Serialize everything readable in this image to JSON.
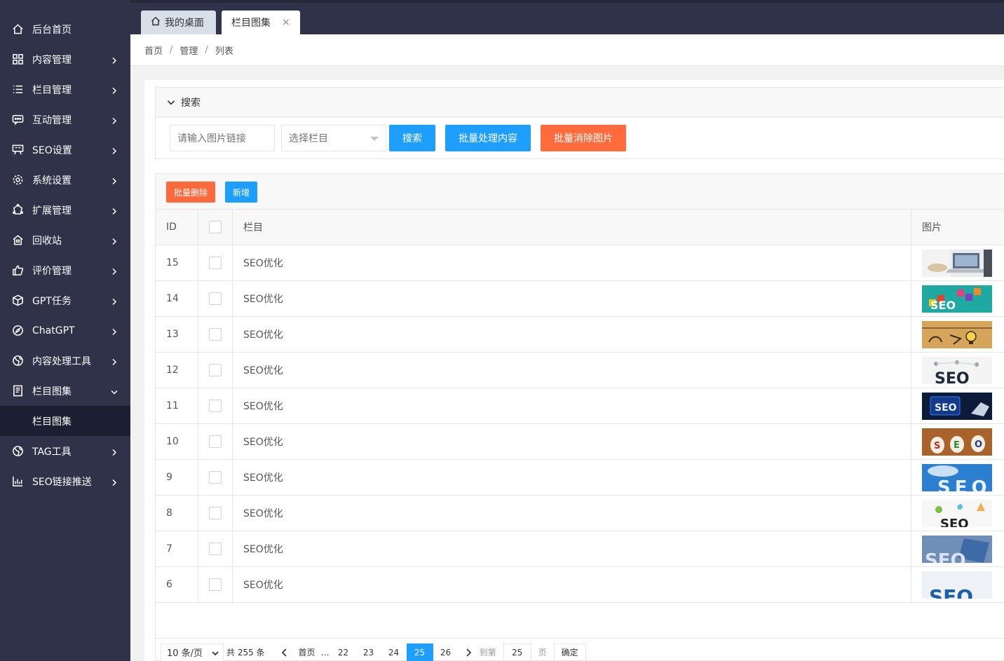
{
  "sidebar": {
    "items": [
      {
        "label": "后台首页",
        "icon": "home-icon",
        "chevron": false
      },
      {
        "label": "内容管理",
        "icon": "grid-icon",
        "chevron": true
      },
      {
        "label": "栏目管理",
        "icon": "list-icon",
        "chevron": true
      },
      {
        "label": "互动管理",
        "icon": "chat-icon",
        "chevron": true
      },
      {
        "label": "SEO设置",
        "icon": "seo-icon",
        "chevron": true
      },
      {
        "label": "系统设置",
        "icon": "gear-icon",
        "chevron": true
      },
      {
        "label": "扩展管理",
        "icon": "extension-icon",
        "chevron": true
      },
      {
        "label": "回收站",
        "icon": "recycle-icon",
        "chevron": true
      },
      {
        "label": "评价管理",
        "icon": "thumbs-up-icon",
        "chevron": true
      },
      {
        "label": "GPT任务",
        "icon": "cube-icon",
        "chevron": true
      },
      {
        "label": "ChatGPT",
        "icon": "compass-icon",
        "chevron": true
      },
      {
        "label": "内容处理工具",
        "icon": "globe-icon",
        "chevron": true
      },
      {
        "label": "栏目图集",
        "icon": "album-icon",
        "chevron": "down"
      },
      {
        "label": "TAG工具",
        "icon": "globe-icon",
        "chevron": true
      },
      {
        "label": "SEO链接推送",
        "icon": "bar-chart-icon",
        "chevron": true
      }
    ],
    "submenu_active": "栏目图集"
  },
  "tabs": {
    "home": "我的桌面",
    "active": "栏目图集",
    "close": "×"
  },
  "breadcrumb": [
    "首页",
    "管理",
    "列表"
  ],
  "search": {
    "title": "搜索",
    "link_placeholder": "请输入图片链接",
    "select_placeholder": "选择栏目",
    "search_label": "搜索",
    "batch_label": "批量处理内容",
    "clear_label": "批量消除图片"
  },
  "toolbar": {
    "delete_label": "批量删除",
    "add_label": "新增"
  },
  "table": {
    "headers": {
      "id": "ID",
      "category": "栏目",
      "image": "图片"
    },
    "rows": [
      {
        "id": "15",
        "category": "SEO优化"
      },
      {
        "id": "14",
        "category": "SEO优化"
      },
      {
        "id": "13",
        "category": "SEO优化"
      },
      {
        "id": "12",
        "category": "SEO优化"
      },
      {
        "id": "11",
        "category": "SEO优化"
      },
      {
        "id": "10",
        "category": "SEO优化"
      },
      {
        "id": "9",
        "category": "SEO优化"
      },
      {
        "id": "8",
        "category": "SEO优化"
      },
      {
        "id": "7",
        "category": "SEO优化"
      },
      {
        "id": "6",
        "category": "SEO优化"
      }
    ]
  },
  "thumb_text": {
    "seo": "SEO",
    "s": "S",
    "e": "E",
    "o": "O"
  },
  "pagination": {
    "limit": "10 条/页",
    "total": "共 255 条",
    "first": "首页",
    "ellipsis": "…",
    "pages": [
      "22",
      "23",
      "24",
      "25",
      "26"
    ],
    "current": "25",
    "goto_label": "到第",
    "goto_value": "25",
    "page_unit": "页",
    "confirm": "确定"
  },
  "colors": {
    "sidebar_bg": "#2f3249",
    "submenu_active_bg": "#1c1e31",
    "primary": "#1e9fff",
    "danger": "#ff5722"
  }
}
